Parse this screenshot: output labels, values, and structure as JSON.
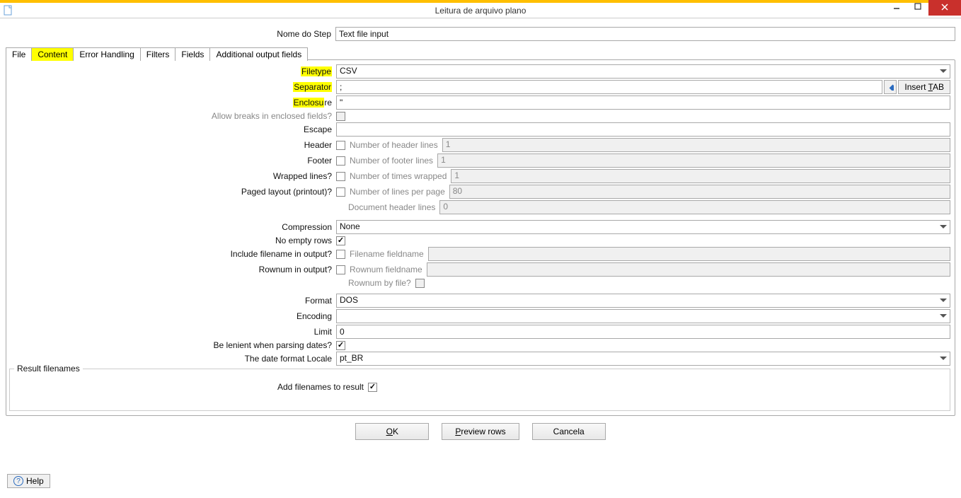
{
  "window": {
    "title": "Leitura de arquivo plano"
  },
  "step_name": {
    "label": "Nome do Step",
    "value": "Text file input"
  },
  "tabs": [
    "File",
    "Content",
    "Error Handling",
    "Filters",
    "Fields",
    "Additional output fields"
  ],
  "active_tab": "Content",
  "fields": {
    "filetype": {
      "label_hl": "Filetype",
      "value": "CSV"
    },
    "separator": {
      "label_hl": "Separator",
      "value": ";",
      "insert_tab": "Insert TAB"
    },
    "enclosure": {
      "label_hl": "Enclosu",
      "label_rest": "re",
      "value": "\""
    },
    "allow_breaks": {
      "label": "Allow breaks in enclosed fields?",
      "checked": false,
      "disabled": true
    },
    "escape": {
      "label": "Escape",
      "value": ""
    },
    "header": {
      "label": "Header",
      "checked": false,
      "sublabel": "Number of header lines",
      "subvalue": "1"
    },
    "footer": {
      "label": "Footer",
      "checked": false,
      "sublabel": "Number of footer lines",
      "subvalue": "1"
    },
    "wrapped": {
      "label": "Wrapped lines?",
      "checked": false,
      "sublabel": "Number of times wrapped",
      "subvalue": "1"
    },
    "paged": {
      "label": "Paged layout (printout)?",
      "checked": false,
      "sublabel": "Number of lines per page",
      "subvalue": "80"
    },
    "doc_header": {
      "sublabel": "Document header lines",
      "subvalue": "0"
    },
    "compression": {
      "label": "Compression",
      "value": "None"
    },
    "no_empty": {
      "label": "No empty rows",
      "checked": true
    },
    "include_filename": {
      "label": "Include filename in output?",
      "checked": false,
      "sublabel": "Filename fieldname",
      "subvalue": ""
    },
    "rownum": {
      "label": "Rownum in output?",
      "checked": false,
      "sublabel": "Rownum fieldname",
      "subvalue": ""
    },
    "rownum_by_file": {
      "sublabel": "Rownum by file?",
      "checked": false
    },
    "format": {
      "label": "Format",
      "value": "DOS"
    },
    "encoding": {
      "label": "Encoding",
      "value": ""
    },
    "limit": {
      "label": "Limit",
      "value": "0"
    },
    "lenient": {
      "label": "Be lenient when parsing dates?",
      "checked": true
    },
    "locale": {
      "label": "The date format Locale",
      "value": "pt_BR"
    }
  },
  "group": {
    "title": "Result filenames",
    "add_filenames": {
      "label": "Add filenames to result",
      "checked": true
    }
  },
  "buttons": {
    "ok": "OK",
    "preview": "Preview rows",
    "cancel": "Cancela"
  },
  "help": "Help"
}
